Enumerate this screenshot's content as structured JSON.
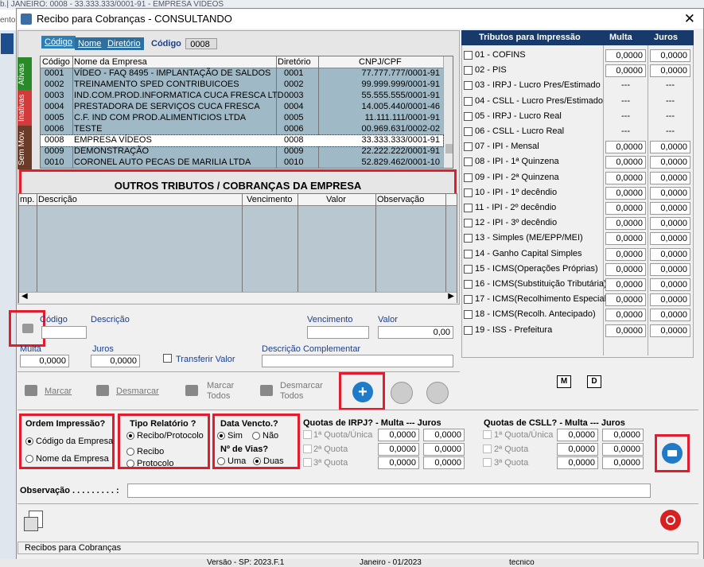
{
  "background": {
    "top_strip": "b.| JANEIRO: 0008 - 33.333.333/0001-91 - EMPRESA VIDEOS",
    "left_strip": "ento"
  },
  "window": {
    "title": "Recibo para Cobranças - CONSULTANDO",
    "close": "✕"
  },
  "company_tabs": {
    "codigo": "Código",
    "nome": "Nome",
    "diretorio": "Diretório",
    "codigo_label": "Código",
    "codigo_value": "0008"
  },
  "vertical_tabs": {
    "ativas": "Ativas",
    "inativas": "Inativas",
    "sem_mov": "Sem Mov."
  },
  "companies": {
    "headers": {
      "codigo": "Código",
      "nome": "Nome da Empresa",
      "diretorio": "Diretório",
      "cnpj": "CNPJ/CPF"
    },
    "rows": [
      {
        "codigo": "0001",
        "nome": "VÍDEO - FAQ 8495 - IMPLANTAÇÃO DE SALDOS",
        "dir": "0001",
        "cnpj": "77.777.777/0001-91"
      },
      {
        "codigo": "0002",
        "nome": "TREINAMENTO SPED CONTRIBUICOES",
        "dir": "0002",
        "cnpj": "99.999.999/0001-91"
      },
      {
        "codigo": "0003",
        "nome": "IND.COM.PROD.INFORMATICA CUCA FRESCA LTD",
        "dir": "0003",
        "cnpj": "55.555.555/0001-91"
      },
      {
        "codigo": "0004",
        "nome": "PRESTADORA DE SERVIÇOS CUCA FRESCA",
        "dir": "0004",
        "cnpj": "14.005.440/0001-46"
      },
      {
        "codigo": "0005",
        "nome": "C.F. IND COM PROD.ALIMENTICIOS LTDA",
        "dir": "0005",
        "cnpj": "11.111.111/0001-91"
      },
      {
        "codigo": "0006",
        "nome": "TESTE",
        "dir": "0006",
        "cnpj": "00.969.631/0002-02"
      },
      {
        "codigo": "0008",
        "nome": "EMPRESA VÍDEOS",
        "dir": "0008",
        "cnpj": "33.333.333/0001-91"
      },
      {
        "codigo": "0009",
        "nome": "DEMONSTRAÇÃO",
        "dir": "0009",
        "cnpj": "22.222.222/0001-91"
      },
      {
        "codigo": "0010",
        "nome": "CORONEL AUTO PECAS DE MARILIA LTDA",
        "dir": "0010",
        "cnpj": "52.829.462/0001-10"
      }
    ]
  },
  "outros": {
    "title": "OUTROS TRIBUTOS / COBRANÇAS DA EMPRESA",
    "headers": {
      "imp": "mp.",
      "descricao": "Descrição",
      "vencimento": "Vencimento",
      "valor": "Valor",
      "observacao": "Observação"
    }
  },
  "form": {
    "codigo": "Código",
    "descricao": "Descrição",
    "vencimento": "Vencimento",
    "valor": "Valor",
    "valor_value": "0,00",
    "multa": "Multa",
    "multa_value": "0,0000",
    "juros": "Juros",
    "juros_value": "0,0000",
    "transferir": "Transferir Valor",
    "desc_comp": "Descrição Complementar"
  },
  "toolbar": {
    "marcar": "Marcar",
    "desmarcar": "Desmarcar",
    "marcar_todos_1": "Marcar",
    "marcar_todos_2": "Todos",
    "desmarcar_todos_1": "Desmarcar",
    "desmarcar_todos_2": "Todos"
  },
  "tributos": {
    "header": {
      "title": "Tributos para Impressão",
      "multa": "Multa",
      "juros": "Juros"
    },
    "rows": [
      {
        "label": "01 - COFINS",
        "multa": "0,0000",
        "juros": "0,0000"
      },
      {
        "label": "02 - PIS",
        "multa": "0,0000",
        "juros": "0,0000"
      },
      {
        "label": "03 - IRPJ   -  Lucro Pres/Estimado",
        "multa": "---",
        "juros": "---"
      },
      {
        "label": "04 - CSLL - Lucro Pres/Estimado",
        "multa": "---",
        "juros": "---"
      },
      {
        "label": "05 - IRPJ   -  Lucro Real",
        "multa": "---",
        "juros": "---"
      },
      {
        "label": "06 - CSLL - Lucro Real",
        "multa": "---",
        "juros": "---"
      },
      {
        "label": "07 - IPI  -  Mensal",
        "multa": "0,0000",
        "juros": "0,0000"
      },
      {
        "label": "08 - IPI  -  1ª Quinzena",
        "multa": "0,0000",
        "juros": "0,0000"
      },
      {
        "label": "09 - IPI  -  2ª Quinzena",
        "multa": "0,0000",
        "juros": "0,0000"
      },
      {
        "label": "10 - IPI  -  1º decêndio",
        "multa": "0,0000",
        "juros": "0,0000"
      },
      {
        "label": "11 - IPI  -  2º decêndio",
        "multa": "0,0000",
        "juros": "0,0000"
      },
      {
        "label": "12 - IPI  -  3º decêndio",
        "multa": "0,0000",
        "juros": "0,0000"
      },
      {
        "label": "13 - Simples (ME/EPP/MEI)",
        "multa": "0,0000",
        "juros": "0,0000"
      },
      {
        "label": "14 - Ganho Capital Simples",
        "multa": "0,0000",
        "juros": "0,0000"
      },
      {
        "label": "15 - ICMS(Operações Próprias)",
        "multa": "0,0000",
        "juros": "0,0000"
      },
      {
        "label": "16 - ICMS(Substituição Tributária)",
        "multa": "0,0000",
        "juros": "0,0000"
      },
      {
        "label": "17 - ICMS(Recolhimento Especial)",
        "multa": "0,0000",
        "juros": "0,0000"
      },
      {
        "label": "18 - ICMS(Recolh. Antecipado)",
        "multa": "0,0000",
        "juros": "0,0000"
      },
      {
        "label": "19 - ISS  - Prefeitura",
        "multa": "0,0000",
        "juros": "0,0000"
      }
    ],
    "m_button": "M",
    "d_button": "D"
  },
  "options": {
    "ordem": {
      "title": "Ordem Impressão?",
      "opt1": "Código da Empresa",
      "opt2": "Nome da Empresa"
    },
    "tipo": {
      "title": "Tipo Relatório ?",
      "opt1": "Recibo/Protocolo",
      "opt2": "Recibo",
      "opt3": "Protocolo"
    },
    "data": {
      "title": "Data Vencto.?",
      "sim": "Sim",
      "nao": "Não",
      "vias": "Nº de Vias?",
      "uma": "Uma",
      "duas": "Duas"
    },
    "irpj": {
      "title": "Quotas de IRPJ? -   Multa  ---  Juros",
      "q1": "1ª Quota/Única",
      "q2": "2ª Quota",
      "q3": "3ª Quota",
      "v": "0,0000"
    },
    "csll": {
      "title": "Quotas de CSLL? - Multa  --- Juros",
      "q1": "1ª Quota/Única",
      "q2": "2ª Quota",
      "q3": "3ª Quota",
      "v": "0,0000"
    },
    "observacao": "Observação . . . . . . . . . :"
  },
  "status": {
    "text": "Recibos para Cobranças",
    "versao": "Versão - SP: 2023.F.1",
    "mes": "Janeiro - 01/2023",
    "user": "tecnico"
  },
  "colors": {
    "accent": "#183a6b",
    "highlight_red": "#e21b2d",
    "grid_blue": "#9fb9c6"
  }
}
